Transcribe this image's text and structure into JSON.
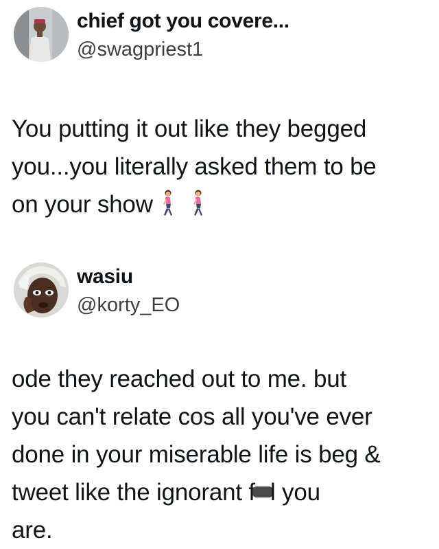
{
  "tweets": [
    {
      "author": {
        "name": "chief got you covere...",
        "handle": "@swagpriest1",
        "avatar_icon": "profile-photo-icon"
      },
      "lines": [
        "You putting it out like they begged",
        "you...you literally asked them to be",
        "on your show"
      ],
      "emoji_icon": "woman-walking-icon"
    },
    {
      "author": {
        "name": "wasiu",
        "handle": "@korty_EO",
        "avatar_icon": "profile-photo-icon"
      },
      "lines": [
        "ode they reached out to me. but",
        "you can't relate cos all you've ever",
        "done in your miserable life is beg &"
      ],
      "line4_before": "tweet like the ignorant f",
      "line4_after": "l you",
      "line5": "are."
    }
  ],
  "colors": {
    "text": "#0f1419",
    "handle": "#3a3f44",
    "background": "#ffffff"
  }
}
